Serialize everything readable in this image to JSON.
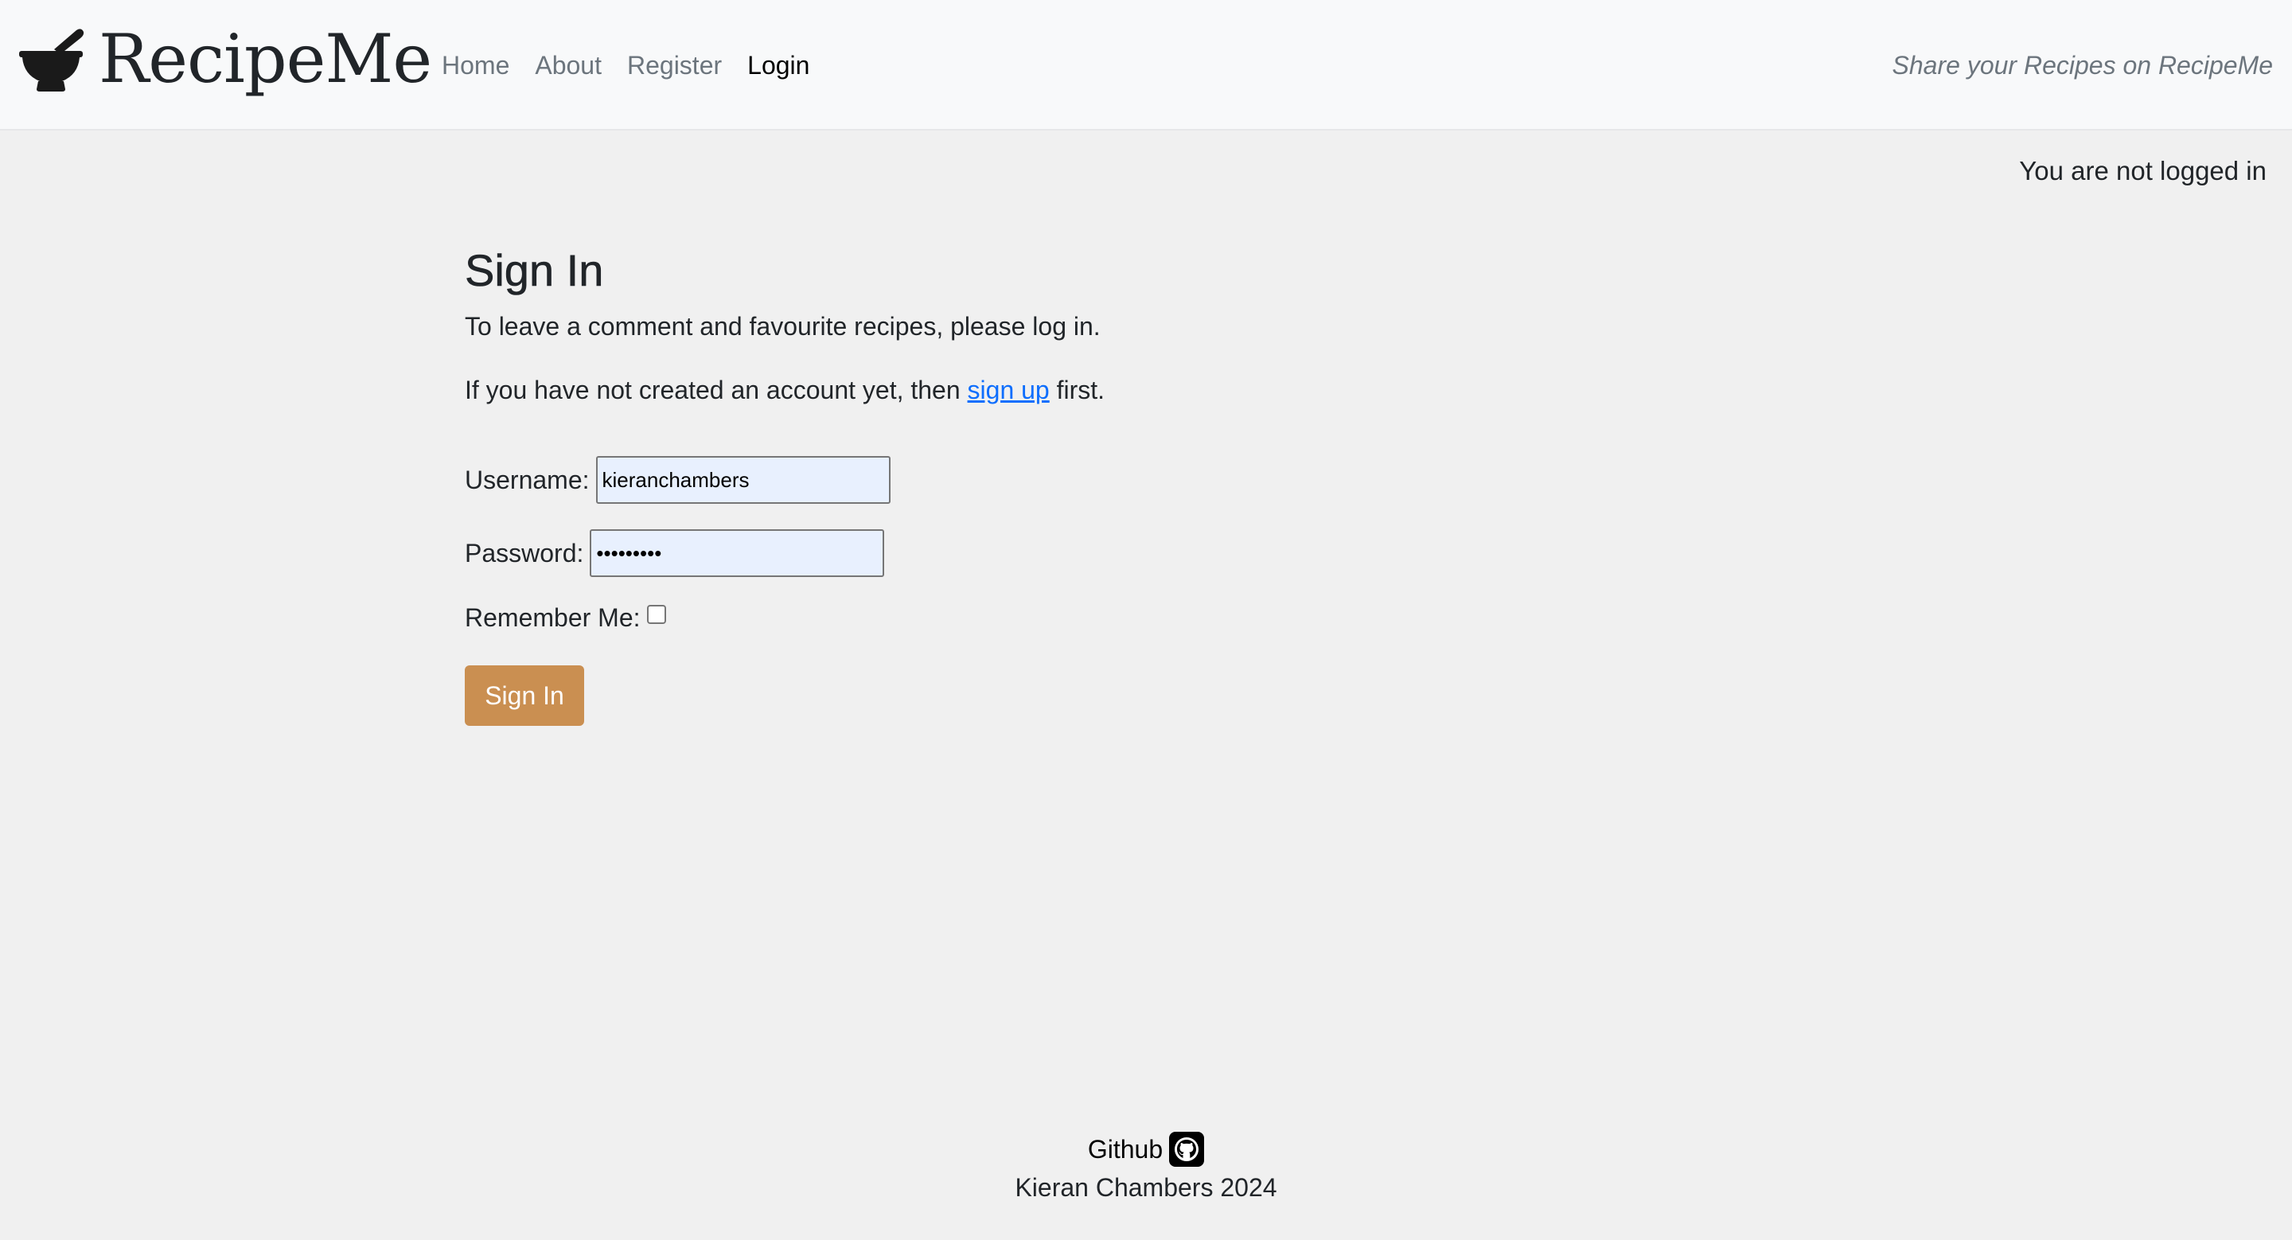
{
  "navbar": {
    "brand": "RecipeMe",
    "brand_icon": "mortar-pestle-icon",
    "links": [
      {
        "label": "Home",
        "active": false
      },
      {
        "label": "About",
        "active": false
      },
      {
        "label": "Register",
        "active": false
      },
      {
        "label": "Login",
        "active": true
      }
    ],
    "tagline": "Share your Recipes on RecipeMe"
  },
  "status": {
    "text": "You are not logged in"
  },
  "signin": {
    "title": "Sign In",
    "intro": "To leave a comment and favourite recipes, please log in.",
    "signup_prefix": "If you have not created an account yet, then ",
    "signup_link": "sign up",
    "signup_suffix": " first.",
    "username_label": "Username:",
    "username_value": "kieranchambers",
    "password_label": "Password:",
    "password_value": "•••••••••",
    "remember_label": "Remember Me:",
    "remember_checked": false,
    "button_label": "Sign In"
  },
  "footer": {
    "github_label": "Github",
    "github_icon": "github-icon",
    "copyright": "Kieran Chambers 2024"
  },
  "colors": {
    "accent_button": "#ca8f51",
    "link": "#0d6efd",
    "background": "#f0f0f0",
    "navbar_bg": "#f8f9fa"
  }
}
